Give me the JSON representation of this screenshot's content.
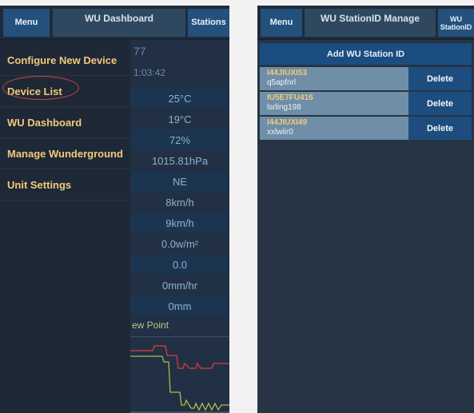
{
  "left_screen": {
    "topbar": {
      "menu_label": "Menu",
      "title": "WU Dashboard",
      "stations_label": "Stations"
    },
    "drawer": {
      "items": [
        {
          "label": "Configure New Device"
        },
        {
          "label": "Device List"
        },
        {
          "label": "WU Dashboard"
        },
        {
          "label": "Manage Wunderground"
        },
        {
          "label": "Unit Settings"
        }
      ]
    },
    "dashboard": {
      "rows": [
        "77",
        "1:03:42",
        "25°C",
        "19°C",
        "72%",
        "1015.81hPa",
        "NE",
        "8km/h",
        "9km/h",
        "0.0w/m²",
        "0.0",
        "0mm/hr",
        "0mm"
      ],
      "chart_label": "ew Point"
    }
  },
  "right_screen": {
    "topbar": {
      "menu_label": "Menu",
      "title": "WU StationID Manage",
      "right_label_line1": "WU",
      "right_label_line2": "StationID"
    },
    "add_button_label": "Add WU Station ID",
    "stations": [
      {
        "id": "I44JIUXI53",
        "key": "q5apfnrl",
        "delete_label": "Delete"
      },
      {
        "id": "IU5E7FU416",
        "key": "lsrling198",
        "delete_label": "Delete"
      },
      {
        "id": "I44JIUXI49",
        "key": "xxlwiir0",
        "delete_label": "Delete"
      }
    ]
  },
  "colors": {
    "accent_text": "#f3c97a",
    "button_blue": "#23517c",
    "chart_red": "#c03a3a",
    "chart_yellow": "#b5b84a",
    "highlight_circle": "#c84545"
  }
}
